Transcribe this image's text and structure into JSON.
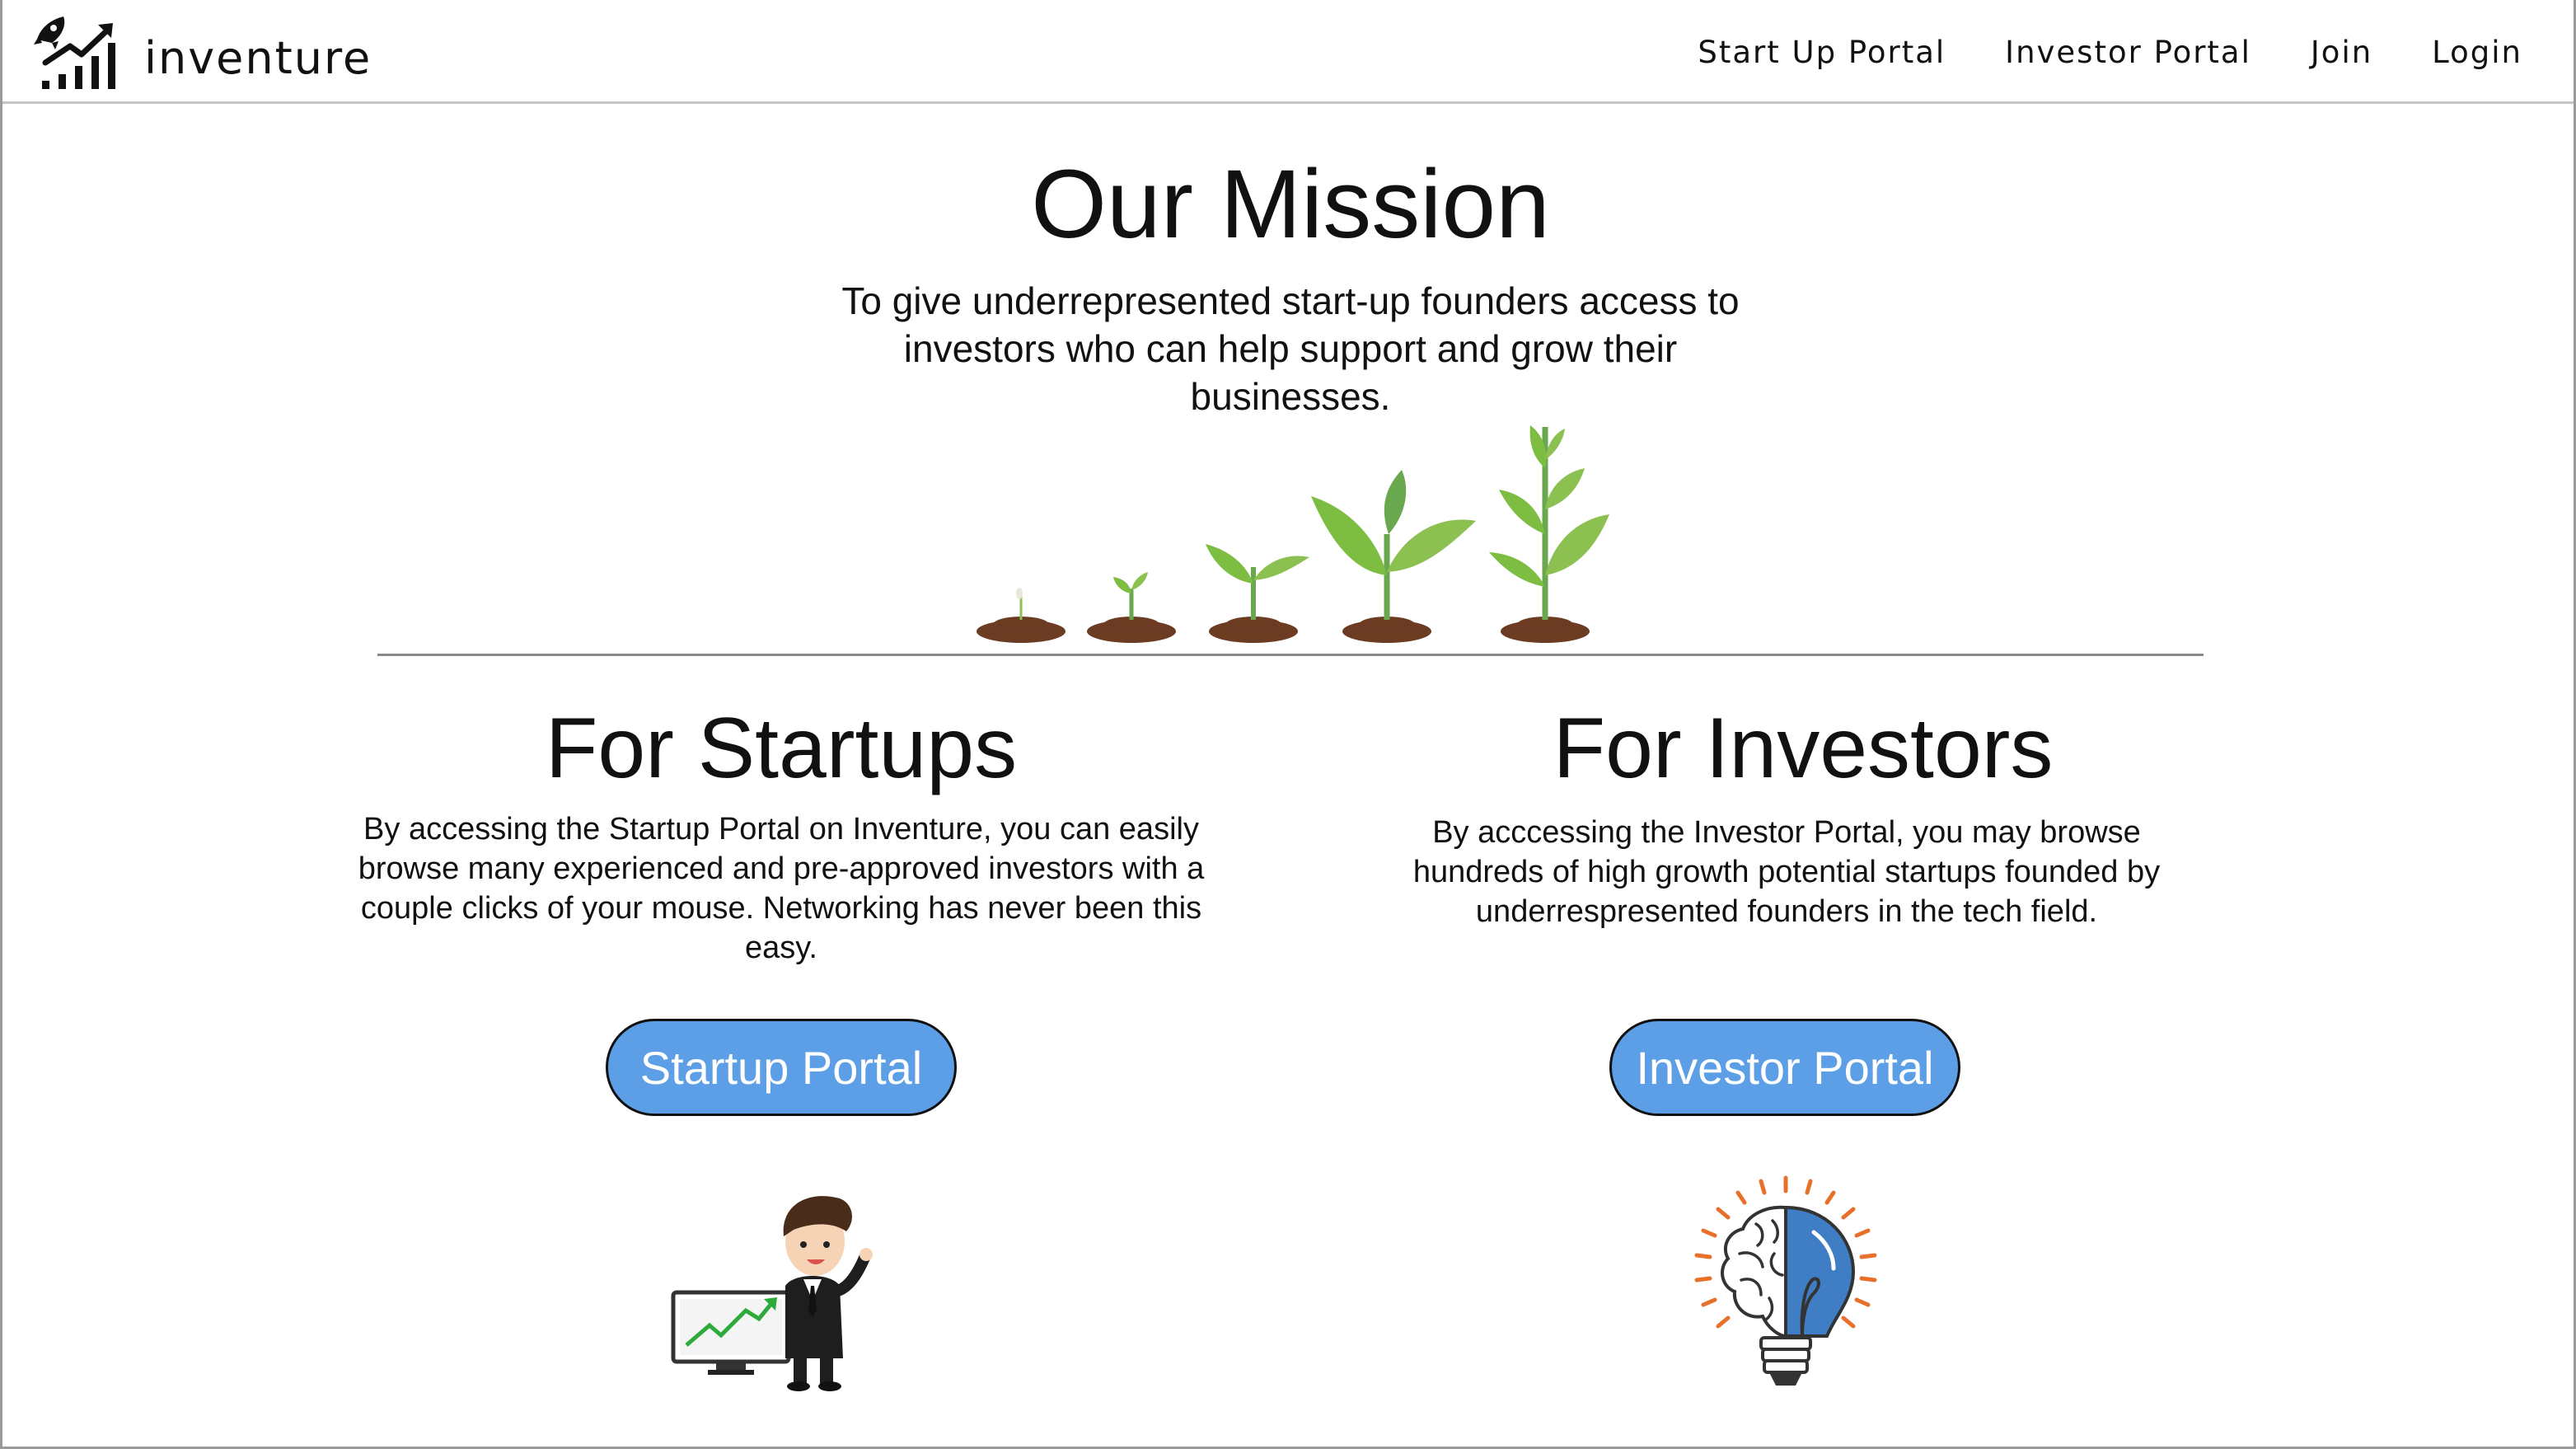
{
  "nav": {
    "brand": "inventure",
    "links": [
      "Start Up Portal",
      "Investor Portal",
      "Join",
      "Login"
    ]
  },
  "mission": {
    "title": "Our Mission",
    "text": "To give underrepresented start-up founders access to investors who can help support and grow their businesses."
  },
  "startups": {
    "title": "For Startups",
    "text": "By accessing the Startup Portal on Inventure, you can easily browse many experienced and pre-approved investors with a couple clicks of your mouse. Networking has never been this easy.",
    "button": "Startup Portal"
  },
  "investors": {
    "title": "For Investors",
    "text": "By acccessing the Investor Portal, you may browse hundreds of high growth potential startups founded by underrespresented founders in the tech field.",
    "button": "Investor Portal"
  },
  "colors": {
    "button_bg": "#5d9fe6",
    "leaf_green": "#7dbd42",
    "soil": "#6b3b22"
  }
}
